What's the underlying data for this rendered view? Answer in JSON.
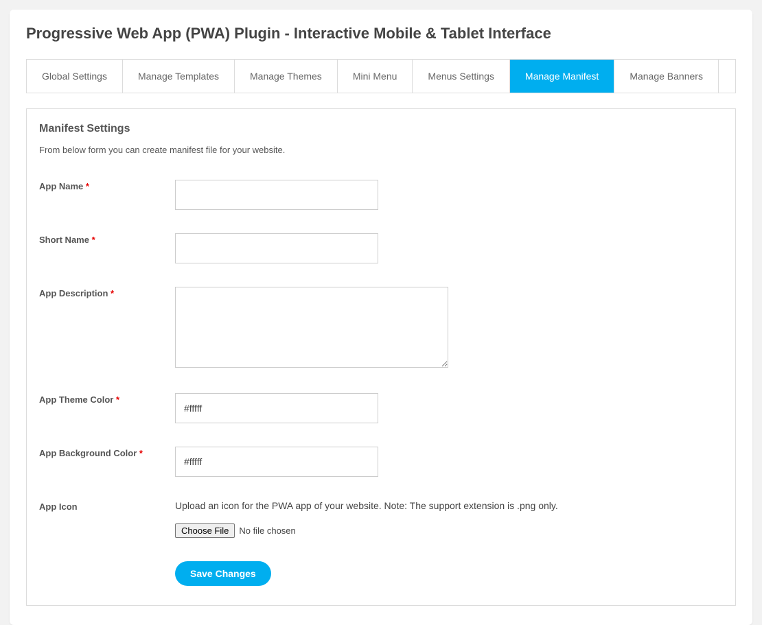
{
  "page_title": "Progressive Web App (PWA) Plugin - Interactive Mobile & Tablet Interface",
  "tabs": [
    {
      "label": "Global Settings",
      "active": false
    },
    {
      "label": "Manage Templates",
      "active": false
    },
    {
      "label": "Manage Themes",
      "active": false
    },
    {
      "label": "Mini Menu",
      "active": false
    },
    {
      "label": "Menus Settings",
      "active": false
    },
    {
      "label": "Manage Manifest",
      "active": true
    },
    {
      "label": "Manage Banners",
      "active": false
    }
  ],
  "panel": {
    "heading": "Manifest Settings",
    "subtext": "From below form you can create manifest file for your website."
  },
  "fields": {
    "app_name": {
      "label": "App Name",
      "required": true,
      "value": ""
    },
    "short_name": {
      "label": "Short Name",
      "required": true,
      "value": ""
    },
    "app_description": {
      "label": "App Description",
      "required": true,
      "value": ""
    },
    "theme_color": {
      "label": "App Theme Color",
      "required": true,
      "value": "#fffff"
    },
    "bg_color": {
      "label": "App Background Color",
      "required": true,
      "value": "#fffff"
    },
    "app_icon": {
      "label": "App Icon",
      "required": false,
      "hint": "Upload an icon for the PWA app of your website. Note: The support extension is .png only.",
      "choose_button": "Choose File",
      "no_file": "No file chosen"
    }
  },
  "required_marker": "*",
  "save_label": "Save Changes"
}
